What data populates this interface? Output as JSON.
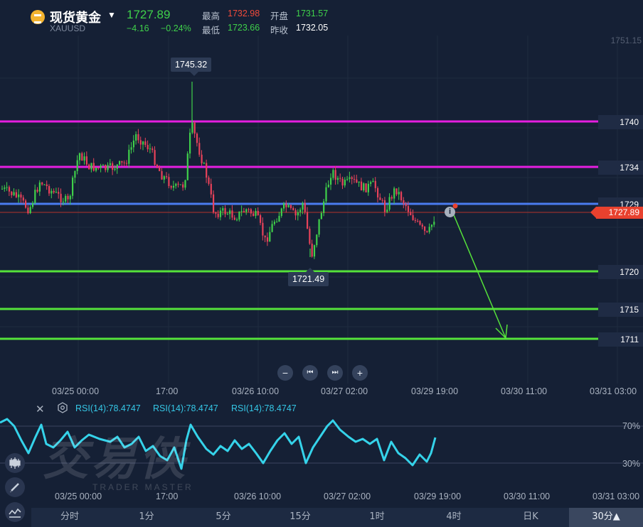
{
  "header": {
    "symbol_name": "现货黄金",
    "symbol_code": "XAUUSD",
    "dropdown_glyph": "▼",
    "last_price": "1727.89",
    "change_abs": "−4.16",
    "change_pct": "−0.24%",
    "high_label": "最高",
    "high_value": "1732.98",
    "open_label": "开盘",
    "open_value": "1731.57",
    "low_label": "最低",
    "low_value": "1723.66",
    "prev_close_label": "昨收",
    "prev_close_value": "1732.05",
    "colors": {
      "up": "#3fd04a",
      "down": "#f04a3a"
    }
  },
  "main_chart": {
    "price_axis_top": "1751.15",
    "current_price_tag": "1727.89",
    "high_callout": "1745.32",
    "low_callout": "1721.49",
    "levels": [
      {
        "label": "1740",
        "color": "#e51ee0"
      },
      {
        "label": "1734",
        "color": "#e51ee0"
      },
      {
        "label": "1729",
        "color": "#4a7cf0"
      },
      {
        "label": "1720",
        "color": "#55e23a"
      },
      {
        "label": "1715",
        "color": "#55e23a"
      },
      {
        "label": "1711",
        "color": "#55e23a"
      }
    ],
    "info_marker": "i",
    "nav": {
      "zoom_out": "−",
      "prev": "⏮",
      "next": "⏭",
      "zoom_in": "+"
    },
    "time_labels": [
      "03/25 00:00",
      "17:00",
      "03/26 10:00",
      "03/27 02:00",
      "03/29 19:00",
      "03/30 11:00",
      "03/31 03:00"
    ]
  },
  "rsi_panel": {
    "close_glyph": "✕",
    "labels": [
      "RSI(14):78.4747",
      "RSI(14):78.4747",
      "RSI(14):78.4747"
    ],
    "level_70": "70%",
    "level_30": "30%",
    "time_labels": [
      "03/25 00:00",
      "17:00",
      "03/26 10:00",
      "03/27 02:00",
      "03/29 19:00",
      "03/30 11:00",
      "03/31 03:00"
    ],
    "line_color": "#35d3ea"
  },
  "watermark": {
    "cn": "交易侠",
    "en": "TRADER MASTER"
  },
  "side_tools": [
    "candles-icon",
    "pen-icon",
    "indicator-icon"
  ],
  "timeframes": {
    "tabs": [
      "分时",
      "1分",
      "5分",
      "15分",
      "1时",
      "4时",
      "日K",
      "30分▲"
    ],
    "active_index": 7
  }
}
